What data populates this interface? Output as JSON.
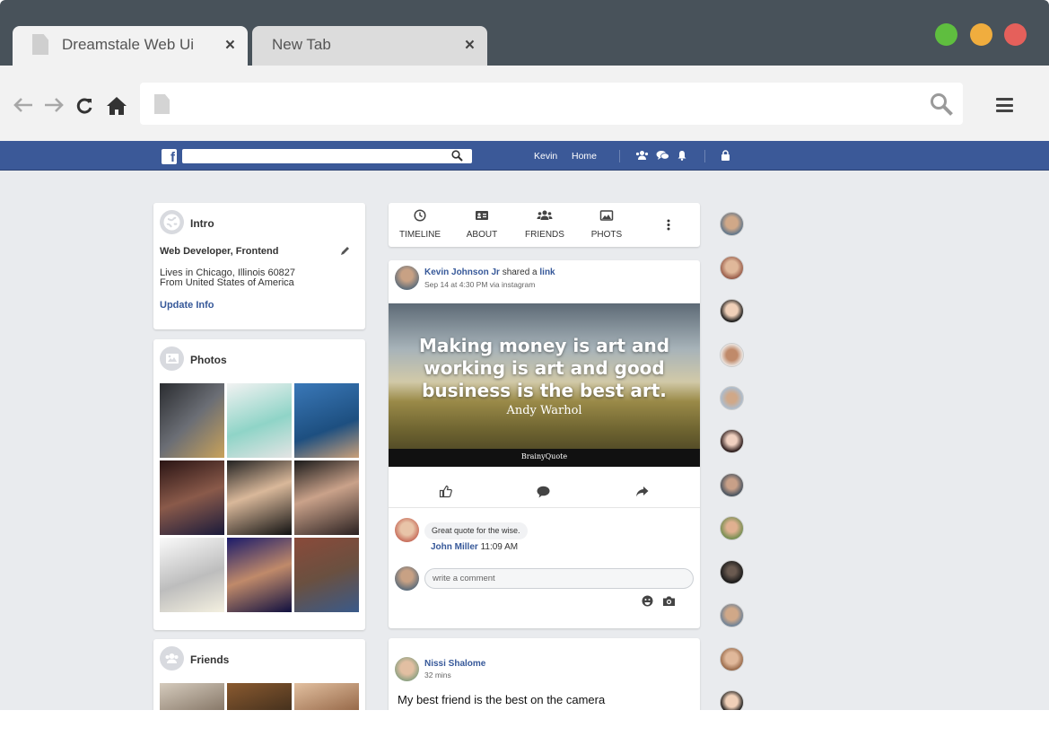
{
  "browser": {
    "tabs": [
      {
        "title": "Dreamstale Web Ui",
        "close": "×"
      },
      {
        "title": "New Tab",
        "close": "×"
      }
    ],
    "traffic_colors": [
      "#5fbe3f",
      "#f0ad3e",
      "#e5605b"
    ],
    "address": ""
  },
  "fbbar": {
    "search_value": "",
    "links": [
      "Kevin",
      "Home"
    ]
  },
  "intro": {
    "title": "Intro",
    "headline": "Web Developer, Frontend",
    "lives": "Lives in Chicago, Illinois 60827",
    "from": "From United States of America",
    "update": "Update Info"
  },
  "photos": {
    "title": "Photos",
    "tiles": [
      "#4b4e55",
      "#d6e7e5",
      "#2d6a9c",
      "#5c3d3a",
      "#3f3f3f",
      "#2f2a2a",
      "#f0eee6",
      "#262a5a",
      "#7a5046"
    ]
  },
  "friends": {
    "title": "Friends",
    "tiles": [
      "#b8a999",
      "#6a4c33",
      "#c59b7a"
    ]
  },
  "profile_tabs": [
    {
      "label": "TIMELINE",
      "icon": "clock-icon"
    },
    {
      "label": "ABOUT",
      "icon": "id-card-icon"
    },
    {
      "label": "FRIENDS",
      "icon": "people-icon"
    },
    {
      "label": "PHOTS",
      "icon": "image-icon"
    }
  ],
  "post1": {
    "author": "Kevin Johnson Jr",
    "shared_text": "shared a",
    "link_text": "link",
    "meta": "Sep 14 at 4:30 PM via instagram",
    "quote_line1": "Making money is art and",
    "quote_line2": "working is art and good",
    "quote_line3": "business is the best art.",
    "quote_author": "Andy Warhol",
    "quote_brand": "BrainyQuote",
    "comment_text": "Great quote for the wise.",
    "comment_author": "John Miller",
    "comment_time": "11:09 AM",
    "comment_placeholder": "write a comment"
  },
  "post2": {
    "author": "Nissi Shalome",
    "meta": "32 mins",
    "text": "My best friend is the best on the camera"
  },
  "rail_avatars": [
    "#4a6b8a",
    "#8a4a3a",
    "#2a2a2a",
    "#a06a4a",
    "#5a7a9a",
    "#3a2a2a",
    "#3a4a5a",
    "#6a8a4a",
    "#2a2a2a",
    "#5a7a9a",
    "#8a5a3a",
    "#4a3a2a"
  ]
}
